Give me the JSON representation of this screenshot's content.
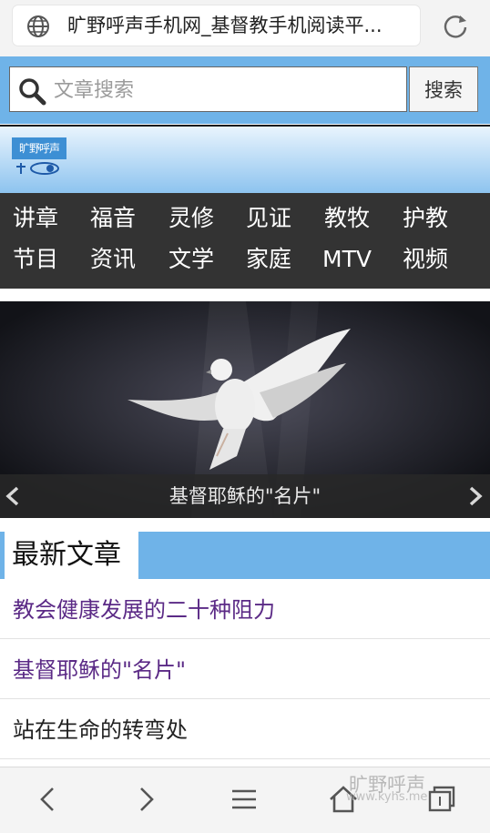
{
  "browser": {
    "url_title": "旷野呼声手机网_基督教手机阅读平..."
  },
  "search": {
    "placeholder": "文章搜索",
    "button": "搜索"
  },
  "logo": {
    "text": "旷野呼声"
  },
  "nav": {
    "rows": [
      [
        "讲章",
        "福音",
        "灵修",
        "见证",
        "教牧",
        "护教"
      ],
      [
        "节目",
        "资讯",
        "文学",
        "家庭",
        "MTV",
        "视频"
      ]
    ]
  },
  "banner": {
    "caption": "基督耶稣的\"名片\""
  },
  "section": {
    "title": "最新文章"
  },
  "articles": [
    {
      "title": "教会健康发展的二十种阻力",
      "visited": true
    },
    {
      "title": "基督耶稣的\"名片\"",
      "visited": true
    },
    {
      "title": "站在生命的转弯处",
      "visited": false
    }
  ],
  "colors": {
    "accent": "#6fb3e8",
    "nav_bg": "#333333",
    "visited_link": "#5b2a86",
    "unvisited_link": "#222222"
  },
  "watermark": {
    "text": "旷野呼声",
    "url": "www.kyhs.me"
  }
}
